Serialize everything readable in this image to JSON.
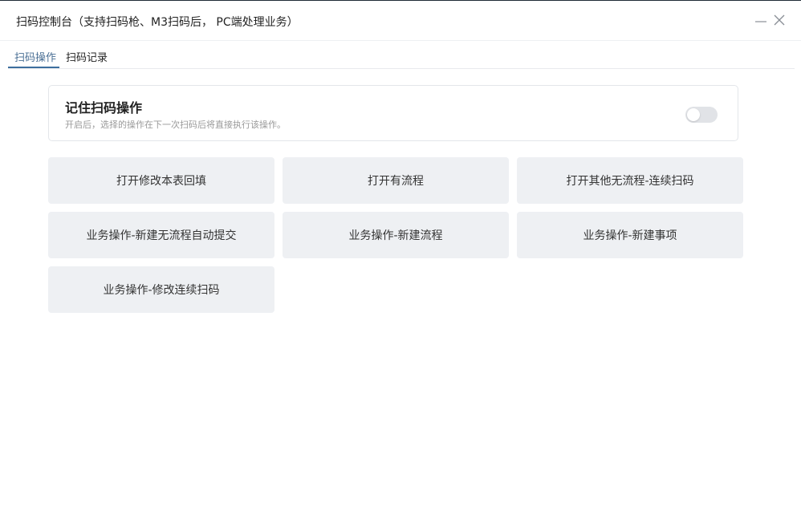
{
  "window": {
    "title": "扫码控制台（支持扫码枪、M3扫码后， PC端处理业务）",
    "minimize_icon": "minimize-icon",
    "close_icon": "close-icon"
  },
  "tabs": [
    {
      "label": "扫码操作",
      "active": true
    },
    {
      "label": "扫码记录",
      "active": false
    }
  ],
  "remember": {
    "title": "记住扫码操作",
    "description": "开启后，选择的操作在下一次扫码后将直接执行该操作。",
    "enabled": false
  },
  "actions": [
    {
      "label": "打开修改本表回填"
    },
    {
      "label": "打开有流程"
    },
    {
      "label": "打开其他无流程-连续扫码"
    },
    {
      "label": "业务操作-新建无流程自动提交"
    },
    {
      "label": "业务操作-新建流程"
    },
    {
      "label": "业务操作-新建事项"
    },
    {
      "label": "业务操作-修改连续扫码"
    }
  ],
  "colors": {
    "accent": "#3d6f9e",
    "button_bg": "#eef0f3",
    "toggle_off": "#e1e3e7"
  }
}
